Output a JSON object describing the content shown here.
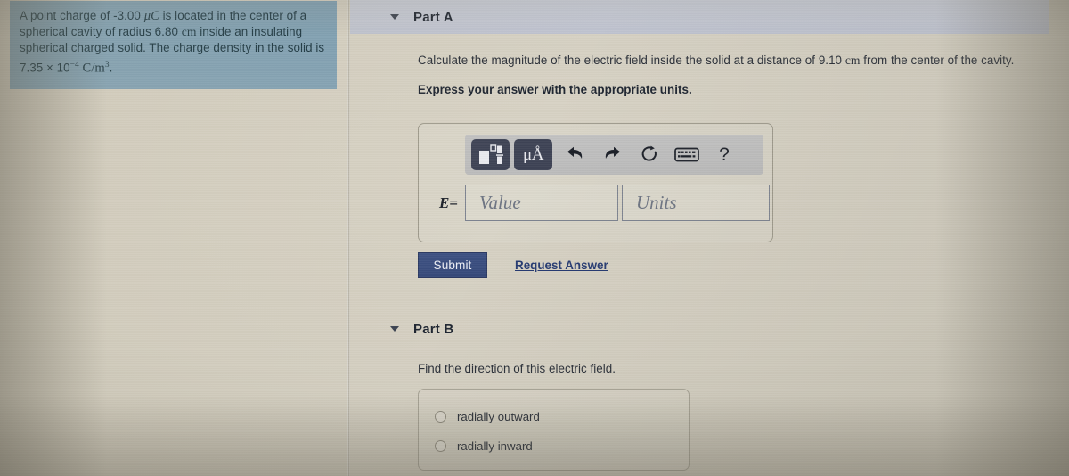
{
  "problem": {
    "text_1": "A point charge of -3.00",
    "charge_symbol": "μC",
    "text_2": "is located in the center of a spherical cavity of radius 6.80",
    "unit_cm_1": "cm",
    "text_3": "inside an insulating spherical charged solid. The charge density in the solid is 7.35 × 10",
    "exponent": "−4",
    "density_unit": "C/m",
    "density_unit_exp": "3",
    "trailing": "."
  },
  "part_a": {
    "title": "Part A",
    "caret": "triangle-down-icon",
    "question_pre": "Calculate the magnitude of the electric field inside the solid at a distance of 9.10",
    "question_unit": "cm",
    "question_post": "from the center of the cavity.",
    "instruction": "Express your answer with the appropriate units.",
    "toolbar": {
      "template_button": "math-template-icon",
      "units_button": "μÅ",
      "undo_button": "undo-icon",
      "redo_button": "redo-icon",
      "reset_button": "reset-icon",
      "keyboard_button": "keyboard-icon",
      "help_button": "?"
    },
    "answer": {
      "label": "E",
      "equals": "=",
      "value_placeholder": "Value",
      "units_placeholder": "Units",
      "value": "",
      "units": ""
    },
    "submit_label": "Submit",
    "request_answer_label": "Request Answer"
  },
  "part_b": {
    "title": "Part B",
    "caret": "triangle-down-icon",
    "question": "Find the direction of this electric field.",
    "choices": [
      {
        "label": "radially outward",
        "selected": false
      },
      {
        "label": "radially inward",
        "selected": false
      }
    ]
  },
  "colors": {
    "problem_box": "#7f9fb4",
    "part_header_band": "#c6cad6",
    "submit_button": "#36497a",
    "link": "#253a72",
    "toolbar_band": "#bfbfbf",
    "toolbar_dark_button": "#3e4355",
    "page_background": "#d4cfc1"
  }
}
